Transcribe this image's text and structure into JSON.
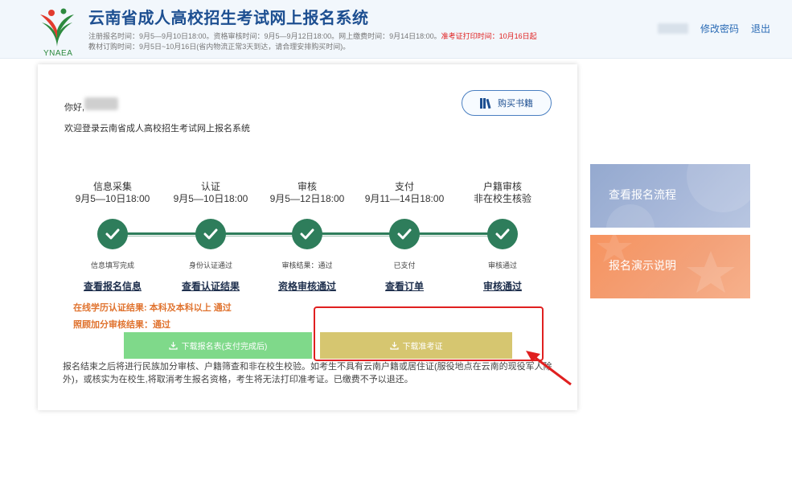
{
  "header": {
    "logo_text": "YNAEA",
    "title": "云南省成人高校招生考试网上报名系统",
    "schedule_line1_a": "注册报名时间：9月5—9月10日18:00。资格审核时间：9月5—9月12日18:00。网上缴费时间：9月14日18:00。",
    "schedule_line1_b": "准考证打印时间：10月16日起",
    "schedule_line2": "教材订购时间：9月5日~10月16日(省内物流正常3天到达，请合理安排购买时间)。",
    "change_password": "修改密码",
    "logout": "退出"
  },
  "card": {
    "greeting": "你好,",
    "welcome": "欢迎登录云南省成人高校招生考试网上报名系统",
    "buy_books": "购买书籍",
    "steps": [
      {
        "title": "信息采集",
        "date": "9月5—10日18:00",
        "status": "信息填写完成",
        "link": "查看报名信息"
      },
      {
        "title": "认证",
        "date": "9月5—10日18:00",
        "status": "身份认证通过",
        "link": "查看认证结果"
      },
      {
        "title": "审核",
        "date": "9月5—12日18:00",
        "status": "审核结果：通过",
        "link": "资格审核通过"
      },
      {
        "title": "支付",
        "date": "9月11—14日18:00",
        "status": "已支付",
        "link": "查看订单"
      },
      {
        "title": "户籍审核",
        "date": "非在校生核验",
        "status": "审核通过",
        "link": "审核通过"
      }
    ],
    "result1": "在线学历认证结果: 本科及本科以上 通过",
    "result2": "照顾加分审核结果：通过",
    "download_form": "下载报名表(支付完成后)",
    "download_ticket": "下载准考证",
    "notice": "报名结束之后将进行民族加分审核、户籍筛查和非在校生校验。如考生不具有云南户籍或居住证(服役地点在云南的现役军人除外)，或核实为在校生,将取消考生报名资格，考生将无法打印准考证。已缴费不予以退还。"
  },
  "side": {
    "flow": "查看报名流程",
    "demo": "报名演示说明"
  },
  "colors": {
    "primary": "#1d4f91",
    "step_green": "#2e7d5b",
    "download_green": "#7fd98a",
    "download_gold": "#d6c670",
    "highlight_red": "#e02020",
    "panel_blue": "#a3b4d6",
    "panel_orange": "#f59c6c"
  }
}
